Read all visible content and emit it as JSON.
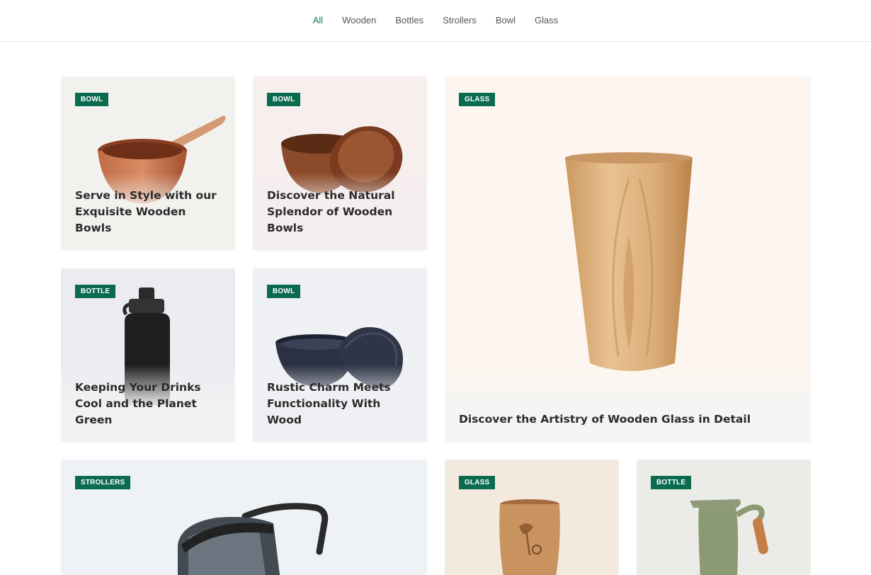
{
  "filters": [
    "All",
    "Wooden",
    "Bottles",
    "Strollers",
    "Bowl",
    "Glass"
  ],
  "active_filter": "All",
  "cards": [
    {
      "badge": "BOWL",
      "title": "Serve in Style with our Exquisite Wooden Bowls",
      "bg": "#f3f1ee"
    },
    {
      "badge": "BOWL",
      "title": "Discover the Natural Splendor of Wooden Bowls",
      "bg": "#f7eeee"
    },
    {
      "badge": "GLASS",
      "title": "Discover the Artistry of Wooden Glass in Detail",
      "bg": "#fdf6f0"
    },
    {
      "badge": "BOTTLE",
      "title": "Keeping Your Drinks Cool and the Planet Green",
      "bg": "#ecebf1"
    },
    {
      "badge": "BOWL",
      "title": "Rustic Charm Meets Functionality With Wood",
      "bg": "#eff0f4"
    },
    {
      "badge": "STROLLERS",
      "title": "",
      "bg": "#eef1f5"
    },
    {
      "badge": "GLASS",
      "title": "",
      "bg": "#f4e9df"
    },
    {
      "badge": "BOTTLE",
      "title": "",
      "bg": "#ebece7"
    }
  ],
  "colors": {
    "accent": "#0d7a58",
    "badge": "#0a6b4f"
  }
}
